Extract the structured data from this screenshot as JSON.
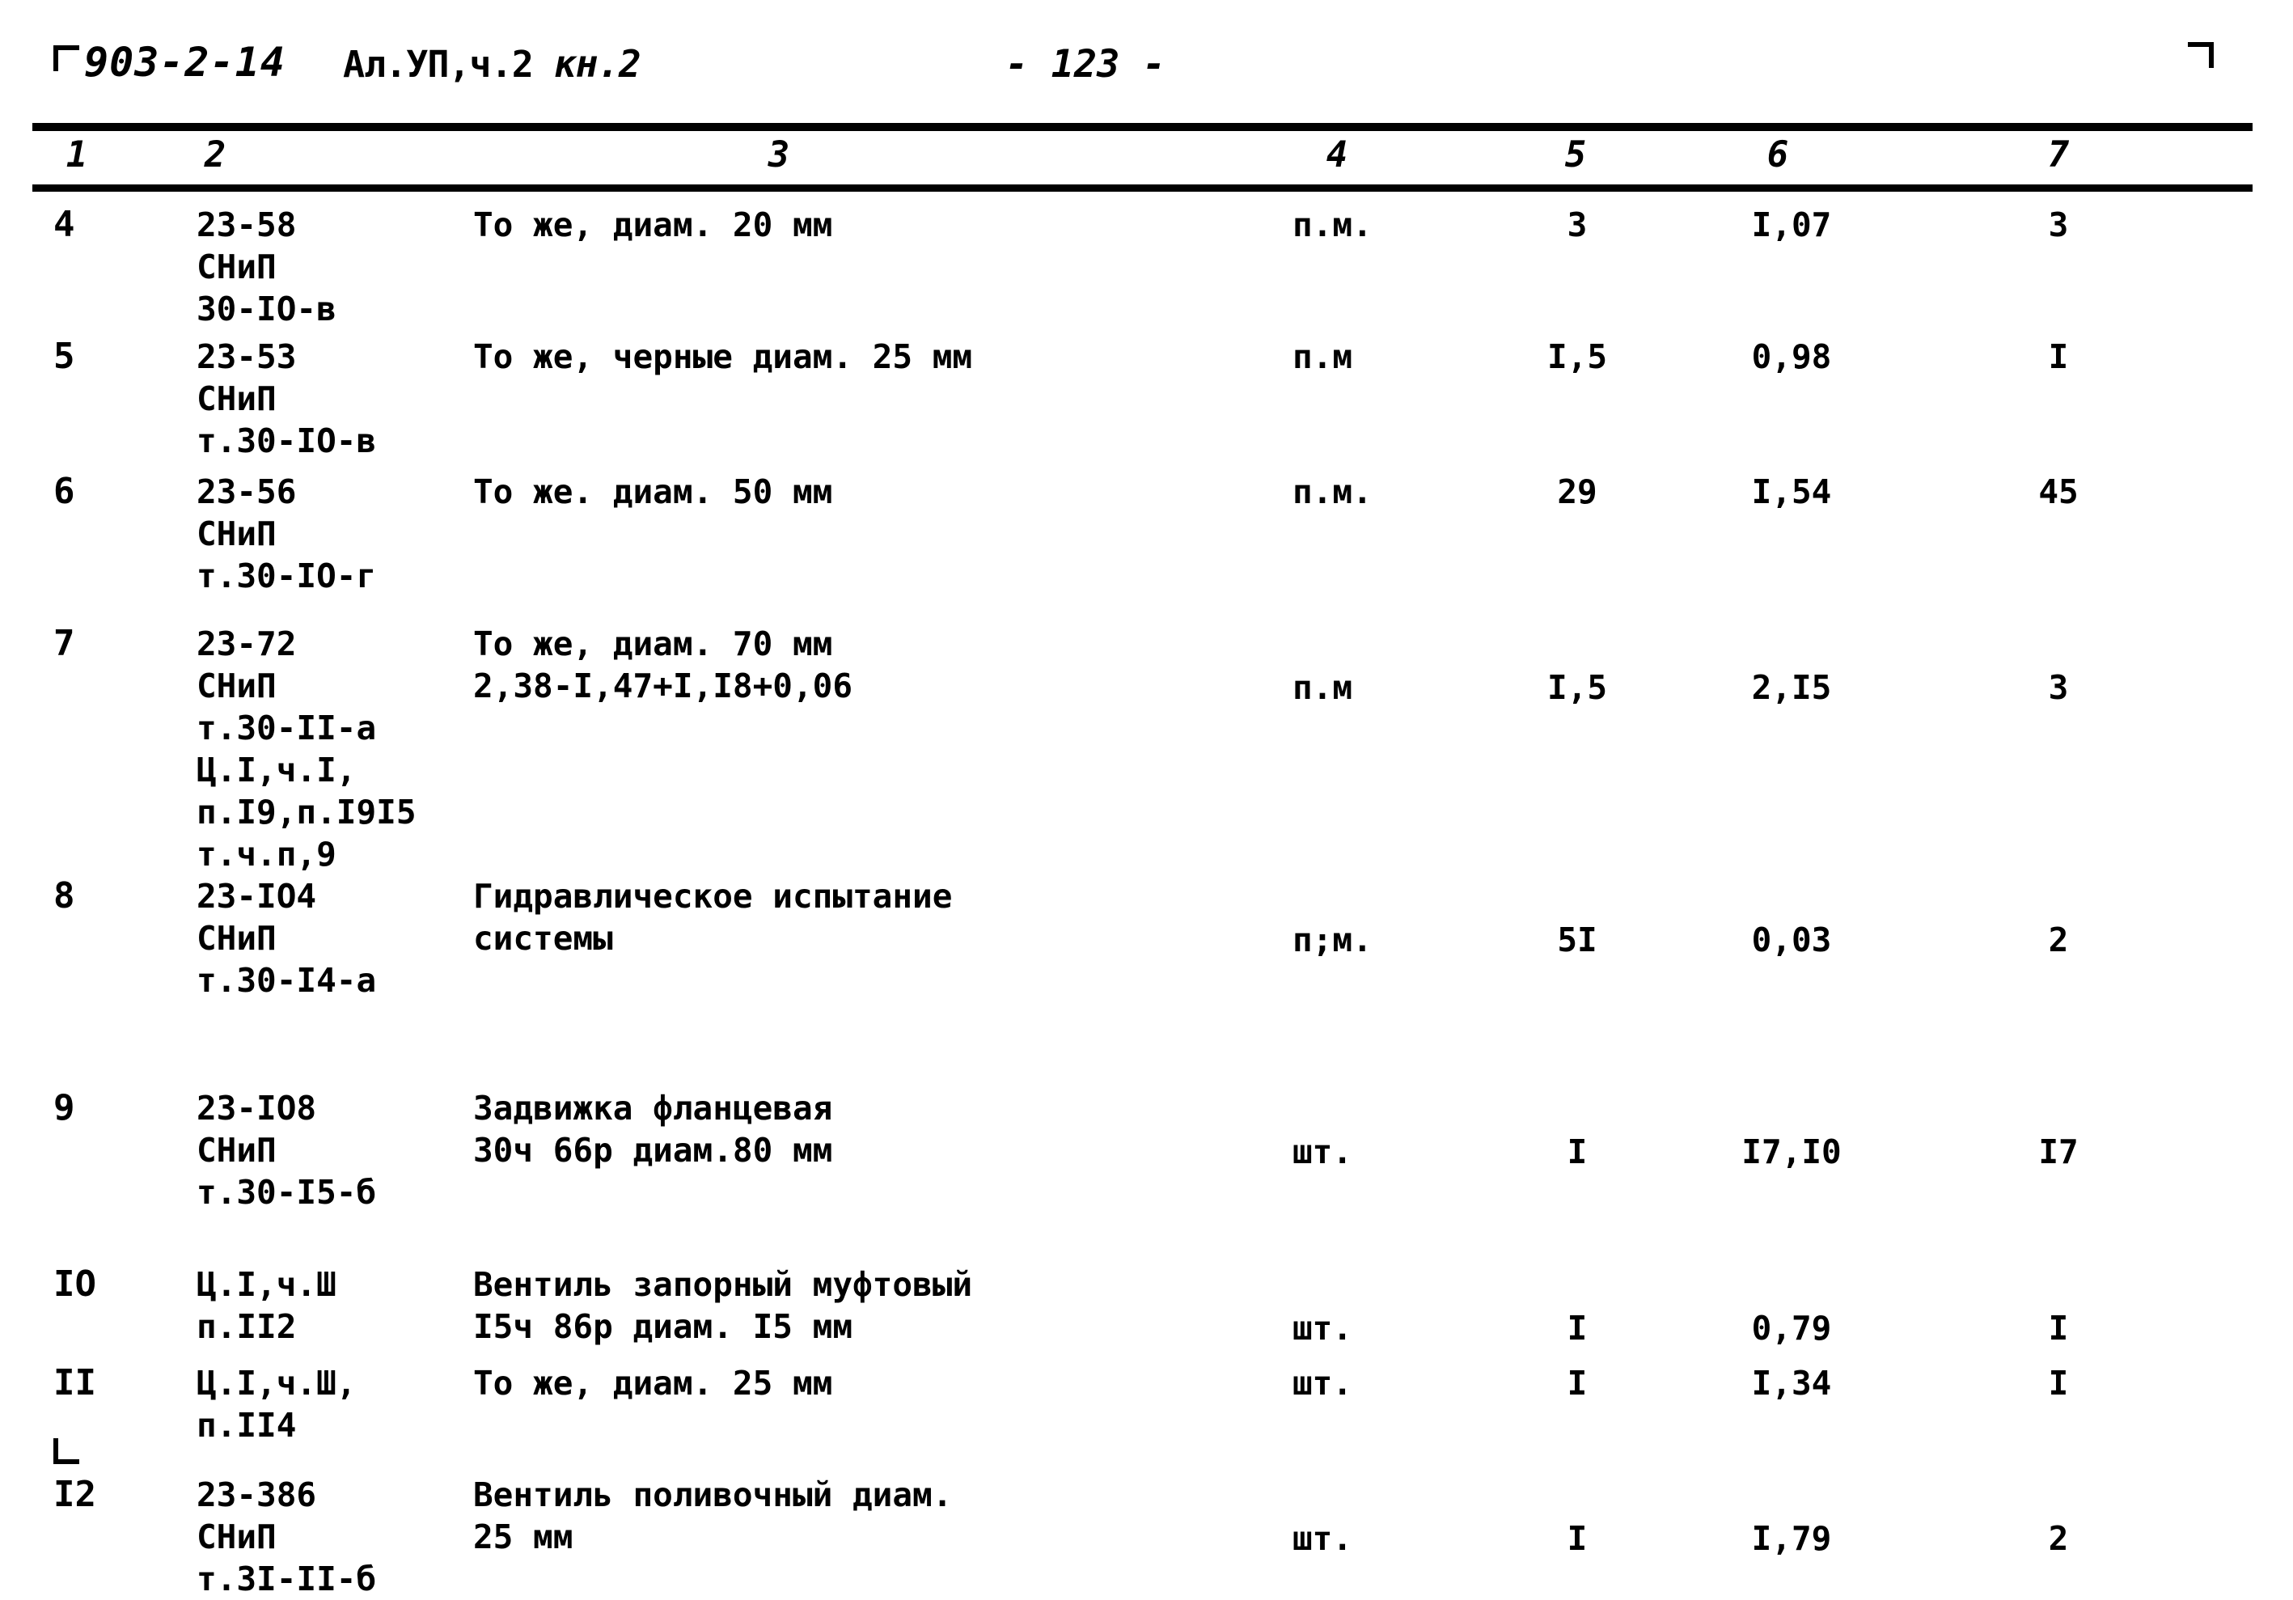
{
  "header": {
    "doc_code": "903-2-14",
    "album": "Ал.УП,ч.2 ",
    "album_kn": "кн.2",
    "page_number": "- 123 -"
  },
  "table": {
    "column_numbers": [
      "1",
      "2",
      "3",
      "4",
      "5",
      "6",
      "7"
    ],
    "rows": [
      {
        "num": "4",
        "code": "23-58\nСНиП\n30-IO-в",
        "desc": "То же, диам. 20 мм",
        "unit": "п.м.",
        "qty": "3",
        "price": "I,07",
        "sum": "3"
      },
      {
        "num": "5",
        "code": "23-53\nСНиП\nт.30-IO-в",
        "desc": "То же, черные диам. 25 мм",
        "unit": "п.м",
        "qty": "I,5",
        "price": "0,98",
        "sum": "I"
      },
      {
        "num": "6",
        "code": "23-56\nСНиП\nт.30-IO-г",
        "desc": "То же. диам. 50 мм",
        "unit": "п.м.",
        "qty": "29",
        "price": "I,54",
        "sum": "45"
      },
      {
        "num": "7",
        "code": "23-72\nСНиП\nт.30-II-а\nЦ.I,ч.I,\nп.I9,п.I9I5\nт.ч.п,9",
        "desc": "То же, диам. 70 мм\n2,38-I,47+I,I8+0,06",
        "unit": "п.м",
        "qty": "I,5",
        "price": "2,I5",
        "sum": "3"
      },
      {
        "num": "8",
        "code": "23-IO4\nСНиП\nт.30-I4-а",
        "desc": "Гидравлическое испытание\nсистемы",
        "unit": "п;м.",
        "qty": "5I",
        "price": "0,03",
        "sum": "2"
      },
      {
        "num": "9",
        "code": "23-IO8\nСНиП\nт.30-I5-б",
        "desc": "Задвижка фланцевая\n30ч 66р диам.80 мм",
        "unit": "шт.",
        "qty": "I",
        "price": "I7,I0",
        "sum": "I7"
      },
      {
        "num": "IO",
        "code": "Ц.I,ч.Ш\nп.II2",
        "desc": "Вентиль запорный муфтовый\nI5ч 86р диам. I5 мм",
        "unit": "шт.",
        "qty": "I",
        "price": "0,79",
        "sum": "I"
      },
      {
        "num": "II",
        "code": "Ц.I,ч.Ш,\nп.II4",
        "desc": "То же, диам. 25 мм",
        "unit": "шт.",
        "qty": "I",
        "price": "I,34",
        "sum": "I"
      },
      {
        "num": "I2",
        "code": "23-386\nСНиП\nт.3I-II-б",
        "desc": "Вентиль поливочный диам.\n25 мм",
        "unit": "шт.",
        "qty": "I",
        "price": "I,79",
        "sum": "2"
      }
    ]
  }
}
